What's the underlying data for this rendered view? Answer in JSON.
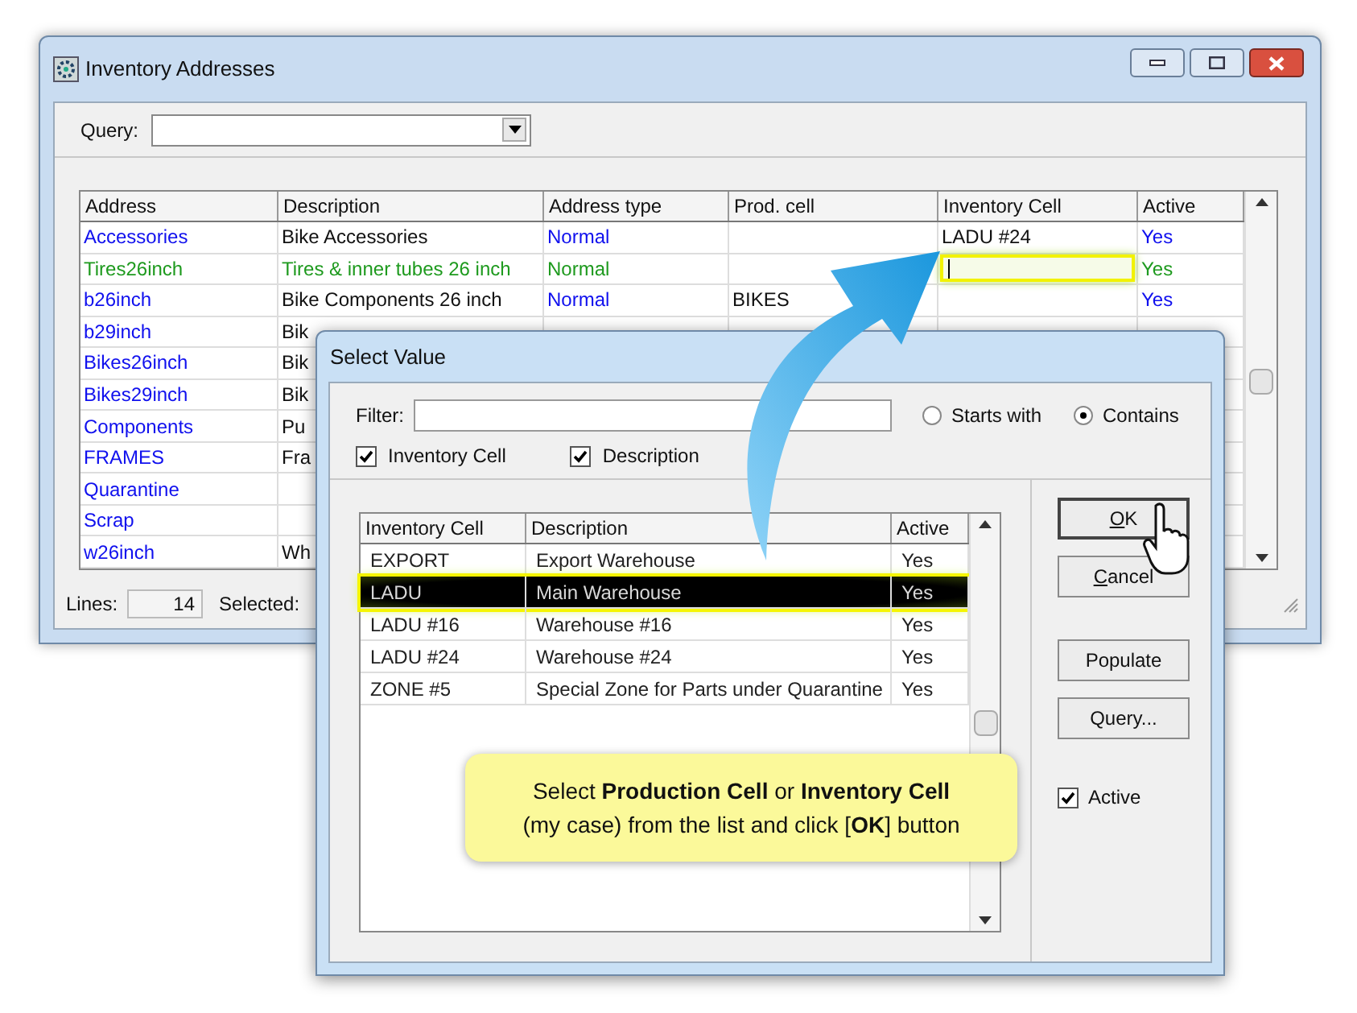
{
  "window": {
    "title": "Inventory Addresses"
  },
  "query": {
    "label": "Query:"
  },
  "grid": {
    "columns": [
      "Address",
      "Description",
      "Address type",
      "Prod. cell",
      "Inventory Cell",
      "Active"
    ],
    "rows": [
      {
        "kind": "normal",
        "address": "Accessories",
        "description": "Bike Accessories",
        "address_type": "Normal",
        "inventory_cell": "LADU #24",
        "active": "Yes"
      },
      {
        "kind": "new",
        "editing": true,
        "address": "Tires26inch",
        "description": "Tires & inner tubes 26 inch",
        "address_type": "Normal",
        "active": "Yes"
      },
      {
        "kind": "normal",
        "address": "b26inch",
        "description": "Bike Components 26 inch",
        "address_type": "Normal",
        "prod_cell": "BIKES",
        "active": "Yes"
      },
      {
        "kind": "normal",
        "address": "b29inch",
        "description": "Bik"
      },
      {
        "kind": "normal",
        "address": "Bikes26inch",
        "description": "Bik"
      },
      {
        "kind": "normal",
        "address": "Bikes29inch",
        "description": "Bik"
      },
      {
        "kind": "normal",
        "address": "Components",
        "description": "Pu"
      },
      {
        "kind": "normal",
        "address": "FRAMES",
        "description": "Fra"
      },
      {
        "kind": "normal",
        "address": "Quarantine"
      },
      {
        "kind": "normal",
        "address": "Scrap"
      },
      {
        "kind": "normal",
        "address": "w26inch",
        "description": "Wh"
      }
    ]
  },
  "status_bar": {
    "lines_label": "Lines:",
    "lines": "14",
    "selected_label": "Selected:"
  },
  "dialog": {
    "title": "Select Value",
    "filter_label": "Filter:",
    "radios": [
      {
        "label": "Starts with",
        "selected": false
      },
      {
        "label": "Contains",
        "selected": true
      }
    ],
    "checkboxes": [
      {
        "label": "Inventory Cell",
        "checked": true
      },
      {
        "label": "Description",
        "checked": true
      }
    ],
    "columns": [
      "Inventory Cell",
      "Description",
      "Active"
    ],
    "rows": [
      {
        "cell": "EXPORT",
        "description": "Export Warehouse",
        "active": "Yes",
        "selected": false
      },
      {
        "cell": "LADU",
        "description": "Main Warehouse",
        "active": "Yes",
        "selected": true
      },
      {
        "cell": "LADU #16",
        "description": "Warehouse #16",
        "active": "Yes",
        "selected": false
      },
      {
        "cell": "LADU #24",
        "description": "Warehouse #24",
        "active": "Yes",
        "selected": false
      },
      {
        "cell": "ZONE #5",
        "description": "Special Zone for Parts under Quarantine",
        "active": "Yes",
        "selected": false
      }
    ],
    "buttons": [
      {
        "label": "OK",
        "focused": true,
        "underline_first": true
      },
      {
        "label": "Cancel",
        "focused": false,
        "underline_first": true
      },
      {
        "label": "Populate",
        "focused": false
      },
      {
        "label": "Query...",
        "focused": false
      }
    ],
    "active_checkbox": {
      "label": "Active",
      "checked": true
    }
  },
  "callout": {
    "lines": [
      "Select **Production Cell** or **Inventory Cell**",
      "(my case) from the list and click [**OK**] button"
    ]
  }
}
